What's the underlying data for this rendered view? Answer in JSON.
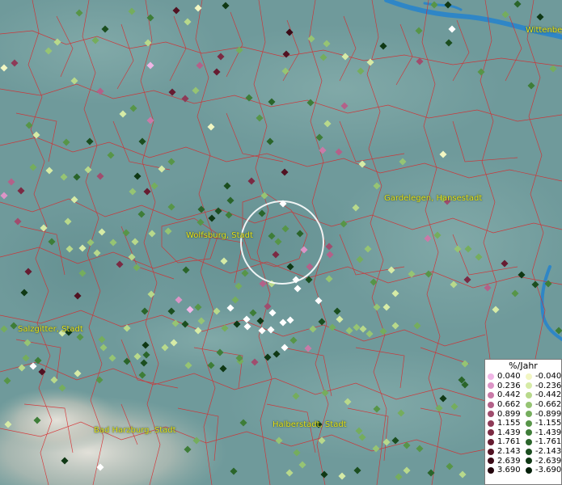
{
  "cities": [
    {
      "id": "wittenberge",
      "label": "Wittenberge"
    },
    {
      "id": "gardelegen",
      "label": "Gardelegen, Hansestadt"
    },
    {
      "id": "wolfsburg",
      "label": "Wolfsburg, Stadt"
    },
    {
      "id": "salzgitter",
      "label": "Salzgitter, Stadt"
    },
    {
      "id": "badharzburg",
      "label": "Bad Harzburg, Stadt"
    },
    {
      "id": "halberstadt",
      "label": "Halberstadt, Stadt"
    }
  ],
  "legend": {
    "title": "%/Jahr",
    "positive": [
      {
        "value": "0.040",
        "color": "#f0b6e6"
      },
      {
        "value": "0.236",
        "color": "#dc94c6"
      },
      {
        "value": "0.442",
        "color": "#c97aa8"
      },
      {
        "value": "0.662",
        "color": "#b36189"
      },
      {
        "value": "0.899",
        "color": "#a04d6e"
      },
      {
        "value": "1.155",
        "color": "#8e3a57"
      },
      {
        "value": "1.439",
        "color": "#7b2a43"
      },
      {
        "value": "1.761",
        "color": "#661c31"
      },
      {
        "value": "2.143",
        "color": "#511222"
      },
      {
        "value": "2.639",
        "color": "#3b0a16"
      },
      {
        "value": "3.690",
        "color": "#22040b"
      }
    ],
    "negative": [
      {
        "value": "-0.040",
        "color": "#f2f6c2"
      },
      {
        "value": "-0.236",
        "color": "#d6eba6"
      },
      {
        "value": "-0.442",
        "color": "#b8d98b"
      },
      {
        "value": "-0.662",
        "color": "#96c473"
      },
      {
        "value": "-0.899",
        "color": "#75ad5d"
      },
      {
        "value": "-1.155",
        "color": "#579548"
      },
      {
        "value": "-1.439",
        "color": "#3e7d38"
      },
      {
        "value": "-1.761",
        "color": "#2a652a"
      },
      {
        "value": "-2.143",
        "color": "#1b4e1f"
      },
      {
        "value": "-2.639",
        "color": "#0f3814"
      },
      {
        "value": "-3.690",
        "color": "#05200a"
      }
    ]
  },
  "colors": {
    "boundary": "#d8282b",
    "river": "#2f86c6",
    "label": "#e8e21a",
    "selection_ring": "#ffffff",
    "white_marker": "#ffffff"
  }
}
